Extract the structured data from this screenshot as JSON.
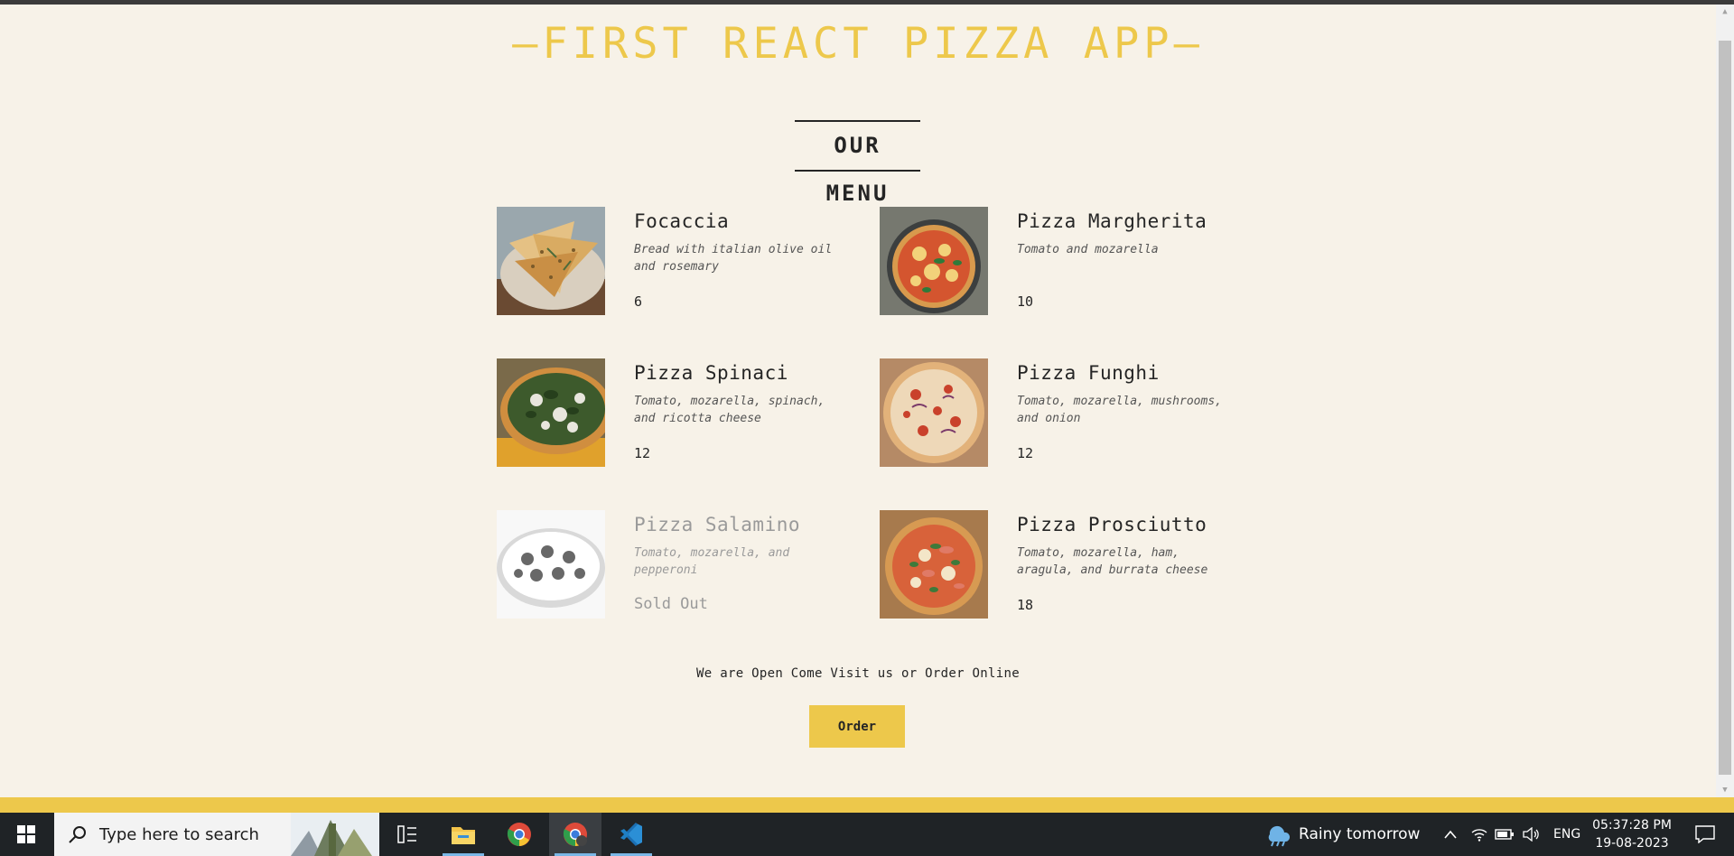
{
  "header": {
    "title": "—First React Pizza App—"
  },
  "menu": {
    "title": "Our Menu",
    "pizzas": [
      {
        "name": "Focaccia",
        "ingredients": "Bread with italian olive oil and rosemary",
        "price": "6",
        "sold_out": false
      },
      {
        "name": "Pizza Margherita",
        "ingredients": "Tomato and mozarella",
        "price": "10",
        "sold_out": false
      },
      {
        "name": "Pizza Spinaci",
        "ingredients": "Tomato, mozarella, spinach, and ricotta cheese",
        "price": "12",
        "sold_out": false
      },
      {
        "name": "Pizza Funghi",
        "ingredients": "Tomato, mozarella, mushrooms, and onion",
        "price": "12",
        "sold_out": false
      },
      {
        "name": "Pizza Salamino",
        "ingredients": "Tomato, mozarella, and pepperoni",
        "price": "Sold Out",
        "sold_out": true
      },
      {
        "name": "Pizza Prosciutto",
        "ingredients": "Tomato, mozarella, ham, aragula, and burrata cheese",
        "price": "18",
        "sold_out": false
      }
    ]
  },
  "footer": {
    "text": "We are Open Come Visit us or Order Online",
    "order_button": "Order"
  },
  "colors": {
    "accent": "#edc84b",
    "background": "#f7f2e8",
    "text": "#252525"
  },
  "taskbar": {
    "search_placeholder": "Type here to search",
    "weather": "Rainy tomorrow",
    "language": "ENG",
    "time": "05:37:28 PM",
    "date": "19-08-2023",
    "icons": [
      "windows-start-icon",
      "search-icon",
      "task-view-icon",
      "file-explorer-icon",
      "chrome-icon",
      "chrome-icon",
      "vscode-icon",
      "rain-cloud-icon",
      "chevron-up-icon",
      "wifi-icon",
      "battery-icon",
      "speaker-icon",
      "notification-icon"
    ]
  }
}
